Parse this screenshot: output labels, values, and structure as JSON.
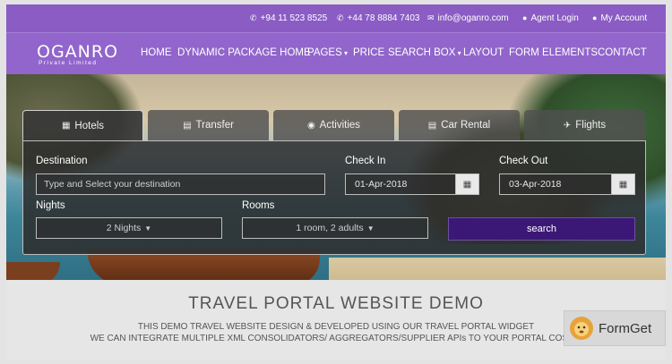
{
  "topbar": {
    "phone1": "+94 11 523 8525",
    "phone2": "+44 78 8884 7403",
    "email": "info@oganro.com",
    "agent_login": "Agent Login",
    "my_account": "My Account"
  },
  "brand": {
    "name": "OGANRO",
    "tagline": "Private Limited"
  },
  "nav": {
    "home": "HOME",
    "dynamic_package_home": "DYNAMIC PACKAGE HOME",
    "pages": "PAGES",
    "price": "PRICE",
    "search_box": "SEARCH BOX",
    "layout": "LAYOUT",
    "form_elements": "FORM ELEMENTS",
    "contact": "CONTACT"
  },
  "tabs": {
    "hotels": "Hotels",
    "transfer": "Transfer",
    "activities": "Activities",
    "car_rental": "Car Rental",
    "flights": "Flights"
  },
  "form": {
    "destination_label": "Destination",
    "destination_placeholder": "Type and Select your destination",
    "checkin_label": "Check In",
    "checkin_value": "01-Apr-2018",
    "checkout_label": "Check Out",
    "checkout_value": "03-Apr-2018",
    "nights_label": "Nights",
    "nights_value": "2 Nights",
    "rooms_label": "Rooms",
    "rooms_value": "1 room, 2 adults",
    "search_label": "search"
  },
  "content": {
    "title": "TRAVEL PORTAL WEBSITE DEMO",
    "line1": "THIS DEMO TRAVEL WEBSITE DESIGN & DEVELOPED USING OUR TRAVEL PORTAL WIDGET",
    "line2": "WE CAN INTEGRATE MULTIPLE XML CONSOLIDATORS/ AGGREGATORS/SUPPLIER APIs TO YOUR PORTAL COST E"
  },
  "watermark": {
    "text": "FormGet"
  },
  "colors": {
    "topbar": "#8a5cc4",
    "navbar": "#9165cc",
    "search_button": "#3c1876"
  }
}
